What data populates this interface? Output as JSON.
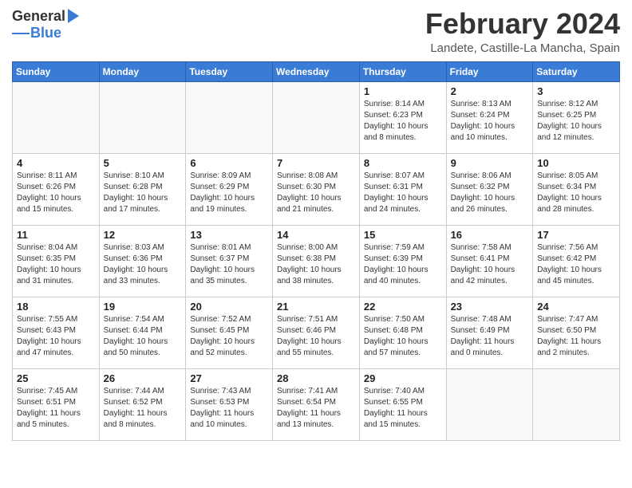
{
  "header": {
    "logo_general": "General",
    "logo_blue": "Blue",
    "month_title": "February 2024",
    "location": "Landete, Castille-La Mancha, Spain"
  },
  "weekdays": [
    "Sunday",
    "Monday",
    "Tuesday",
    "Wednesday",
    "Thursday",
    "Friday",
    "Saturday"
  ],
  "weeks": [
    [
      {
        "day": "",
        "info": ""
      },
      {
        "day": "",
        "info": ""
      },
      {
        "day": "",
        "info": ""
      },
      {
        "day": "",
        "info": ""
      },
      {
        "day": "1",
        "info": "Sunrise: 8:14 AM\nSunset: 6:23 PM\nDaylight: 10 hours\nand 8 minutes."
      },
      {
        "day": "2",
        "info": "Sunrise: 8:13 AM\nSunset: 6:24 PM\nDaylight: 10 hours\nand 10 minutes."
      },
      {
        "day": "3",
        "info": "Sunrise: 8:12 AM\nSunset: 6:25 PM\nDaylight: 10 hours\nand 12 minutes."
      }
    ],
    [
      {
        "day": "4",
        "info": "Sunrise: 8:11 AM\nSunset: 6:26 PM\nDaylight: 10 hours\nand 15 minutes."
      },
      {
        "day": "5",
        "info": "Sunrise: 8:10 AM\nSunset: 6:28 PM\nDaylight: 10 hours\nand 17 minutes."
      },
      {
        "day": "6",
        "info": "Sunrise: 8:09 AM\nSunset: 6:29 PM\nDaylight: 10 hours\nand 19 minutes."
      },
      {
        "day": "7",
        "info": "Sunrise: 8:08 AM\nSunset: 6:30 PM\nDaylight: 10 hours\nand 21 minutes."
      },
      {
        "day": "8",
        "info": "Sunrise: 8:07 AM\nSunset: 6:31 PM\nDaylight: 10 hours\nand 24 minutes."
      },
      {
        "day": "9",
        "info": "Sunrise: 8:06 AM\nSunset: 6:32 PM\nDaylight: 10 hours\nand 26 minutes."
      },
      {
        "day": "10",
        "info": "Sunrise: 8:05 AM\nSunset: 6:34 PM\nDaylight: 10 hours\nand 28 minutes."
      }
    ],
    [
      {
        "day": "11",
        "info": "Sunrise: 8:04 AM\nSunset: 6:35 PM\nDaylight: 10 hours\nand 31 minutes."
      },
      {
        "day": "12",
        "info": "Sunrise: 8:03 AM\nSunset: 6:36 PM\nDaylight: 10 hours\nand 33 minutes."
      },
      {
        "day": "13",
        "info": "Sunrise: 8:01 AM\nSunset: 6:37 PM\nDaylight: 10 hours\nand 35 minutes."
      },
      {
        "day": "14",
        "info": "Sunrise: 8:00 AM\nSunset: 6:38 PM\nDaylight: 10 hours\nand 38 minutes."
      },
      {
        "day": "15",
        "info": "Sunrise: 7:59 AM\nSunset: 6:39 PM\nDaylight: 10 hours\nand 40 minutes."
      },
      {
        "day": "16",
        "info": "Sunrise: 7:58 AM\nSunset: 6:41 PM\nDaylight: 10 hours\nand 42 minutes."
      },
      {
        "day": "17",
        "info": "Sunrise: 7:56 AM\nSunset: 6:42 PM\nDaylight: 10 hours\nand 45 minutes."
      }
    ],
    [
      {
        "day": "18",
        "info": "Sunrise: 7:55 AM\nSunset: 6:43 PM\nDaylight: 10 hours\nand 47 minutes."
      },
      {
        "day": "19",
        "info": "Sunrise: 7:54 AM\nSunset: 6:44 PM\nDaylight: 10 hours\nand 50 minutes."
      },
      {
        "day": "20",
        "info": "Sunrise: 7:52 AM\nSunset: 6:45 PM\nDaylight: 10 hours\nand 52 minutes."
      },
      {
        "day": "21",
        "info": "Sunrise: 7:51 AM\nSunset: 6:46 PM\nDaylight: 10 hours\nand 55 minutes."
      },
      {
        "day": "22",
        "info": "Sunrise: 7:50 AM\nSunset: 6:48 PM\nDaylight: 10 hours\nand 57 minutes."
      },
      {
        "day": "23",
        "info": "Sunrise: 7:48 AM\nSunset: 6:49 PM\nDaylight: 11 hours\nand 0 minutes."
      },
      {
        "day": "24",
        "info": "Sunrise: 7:47 AM\nSunset: 6:50 PM\nDaylight: 11 hours\nand 2 minutes."
      }
    ],
    [
      {
        "day": "25",
        "info": "Sunrise: 7:45 AM\nSunset: 6:51 PM\nDaylight: 11 hours\nand 5 minutes."
      },
      {
        "day": "26",
        "info": "Sunrise: 7:44 AM\nSunset: 6:52 PM\nDaylight: 11 hours\nand 8 minutes."
      },
      {
        "day": "27",
        "info": "Sunrise: 7:43 AM\nSunset: 6:53 PM\nDaylight: 11 hours\nand 10 minutes."
      },
      {
        "day": "28",
        "info": "Sunrise: 7:41 AM\nSunset: 6:54 PM\nDaylight: 11 hours\nand 13 minutes."
      },
      {
        "day": "29",
        "info": "Sunrise: 7:40 AM\nSunset: 6:55 PM\nDaylight: 11 hours\nand 15 minutes."
      },
      {
        "day": "",
        "info": ""
      },
      {
        "day": "",
        "info": ""
      }
    ]
  ]
}
